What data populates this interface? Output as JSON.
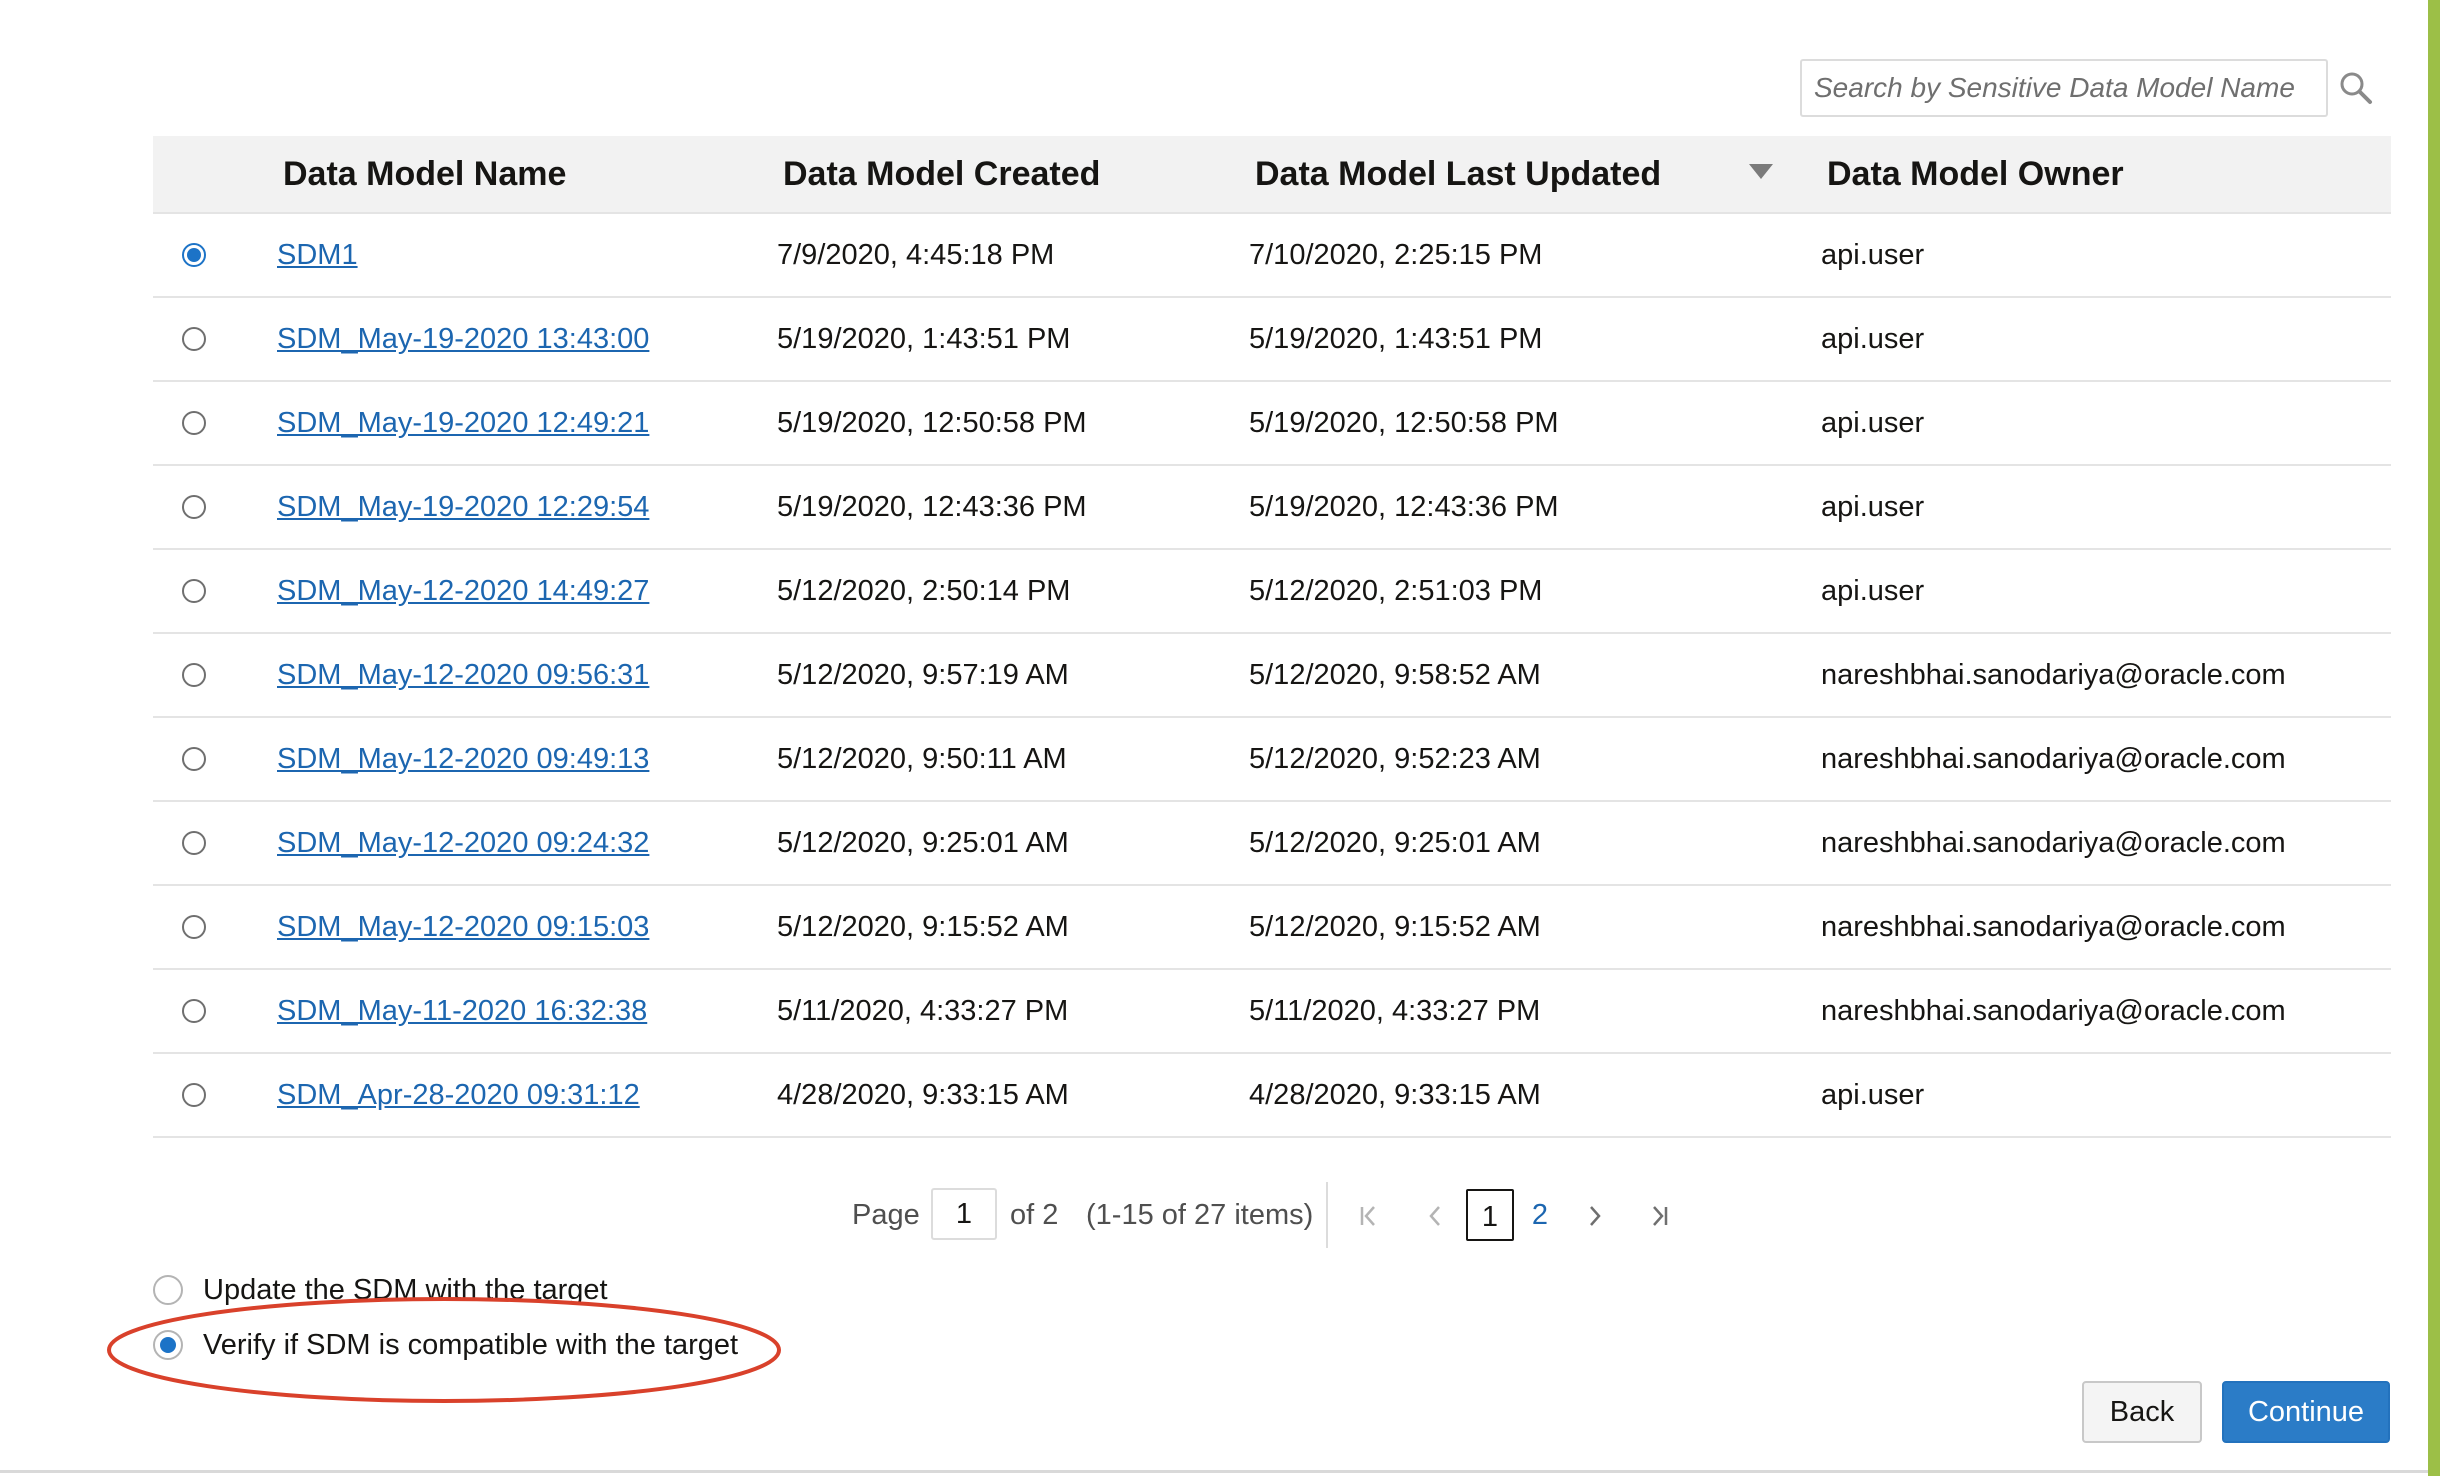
{
  "search": {
    "placeholder": "Search by Sensitive Data Model Name",
    "value": ""
  },
  "table": {
    "columns": [
      "Data Model Name",
      "Data Model Created",
      "Data Model Last Updated",
      "Data Model Owner"
    ],
    "sort_column": "Data Model Last Updated",
    "sort_direction": "descending",
    "selected_row": 0,
    "rows": [
      {
        "name": "SDM1",
        "created": "7/9/2020, 4:45:18 PM",
        "updated": "7/10/2020, 2:25:15 PM",
        "owner": "api.user"
      },
      {
        "name": "SDM_May-19-2020 13:43:00",
        "created": "5/19/2020, 1:43:51 PM",
        "updated": "5/19/2020, 1:43:51 PM",
        "owner": "api.user"
      },
      {
        "name": "SDM_May-19-2020 12:49:21",
        "created": "5/19/2020, 12:50:58 PM",
        "updated": "5/19/2020, 12:50:58 PM",
        "owner": "api.user"
      },
      {
        "name": "SDM_May-19-2020 12:29:54",
        "created": "5/19/2020, 12:43:36 PM",
        "updated": "5/19/2020, 12:43:36 PM",
        "owner": "api.user"
      },
      {
        "name": "SDM_May-12-2020 14:49:27",
        "created": "5/12/2020, 2:50:14 PM",
        "updated": "5/12/2020, 2:51:03 PM",
        "owner": "api.user"
      },
      {
        "name": "SDM_May-12-2020 09:56:31",
        "created": "5/12/2020, 9:57:19 AM",
        "updated": "5/12/2020, 9:58:52 AM",
        "owner": "nareshbhai.sanodariya@oracle.com"
      },
      {
        "name": "SDM_May-12-2020 09:49:13",
        "created": "5/12/2020, 9:50:11 AM",
        "updated": "5/12/2020, 9:52:23 AM",
        "owner": "nareshbhai.sanodariya@oracle.com"
      },
      {
        "name": "SDM_May-12-2020 09:24:32",
        "created": "5/12/2020, 9:25:01 AM",
        "updated": "5/12/2020, 9:25:01 AM",
        "owner": "nareshbhai.sanodariya@oracle.com"
      },
      {
        "name": "SDM_May-12-2020 09:15:03",
        "created": "5/12/2020, 9:15:52 AM",
        "updated": "5/12/2020, 9:15:52 AM",
        "owner": "nareshbhai.sanodariya@oracle.com"
      },
      {
        "name": "SDM_May-11-2020 16:32:38",
        "created": "5/11/2020, 4:33:27 PM",
        "updated": "5/11/2020, 4:33:27 PM",
        "owner": "nareshbhai.sanodariya@oracle.com"
      },
      {
        "name": "SDM_Apr-28-2020 09:31:12",
        "created": "4/28/2020, 9:33:15 AM",
        "updated": "4/28/2020, 9:33:15 AM",
        "owner": "api.user"
      }
    ]
  },
  "pagination": {
    "page_label": "Page",
    "current_page": "1",
    "of_label": "of 2",
    "items_label": "(1-15 of 27 items)",
    "pages": [
      "1",
      "2"
    ],
    "icons": {
      "first": "first-page-icon",
      "prev": "previous-page-icon",
      "next": "next-page-icon",
      "last": "last-page-icon"
    }
  },
  "options": {
    "update_label": "Update the SDM with the target",
    "verify_label": "Verify if SDM is compatible with the target",
    "selected": "verify"
  },
  "buttons": {
    "back": "Back",
    "continue": "Continue"
  },
  "colors": {
    "link": "#1c66b0",
    "accent": "#2b7cc7",
    "highlight": "#d9412b",
    "side_stripe": "#9cbf47"
  }
}
